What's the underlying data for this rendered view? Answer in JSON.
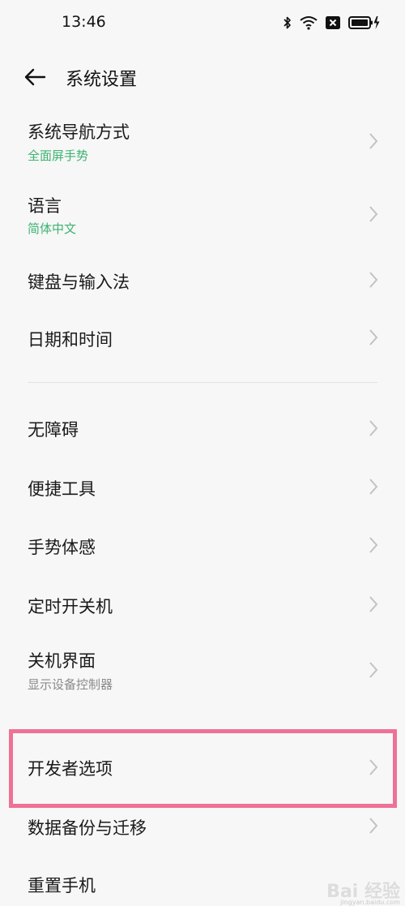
{
  "status_bar": {
    "time": "13:46",
    "icons": [
      "bluetooth-icon",
      "wifi-icon",
      "sim-disabled-icon",
      "battery-charging-icon"
    ]
  },
  "header": {
    "title": "系统设置",
    "back_icon": "arrow-left-icon"
  },
  "items": [
    {
      "title": "系统导航方式",
      "subtitle": "全面屏手势",
      "subtitle_color": "#3cb371"
    },
    {
      "title": "语言",
      "subtitle": "简体中文",
      "subtitle_color": "#3cb371"
    },
    {
      "title": "键盘与输入法"
    },
    {
      "title": "日期和时间"
    },
    {
      "title": "无障碍"
    },
    {
      "title": "便捷工具"
    },
    {
      "title": "手势体感"
    },
    {
      "title": "定时开关机"
    },
    {
      "title": "关机界面",
      "subtitle": "显示设备控制器",
      "subtitle_color": "#8a8a8a"
    },
    {
      "title": "开发者选项",
      "highlighted": true
    },
    {
      "title": "数据备份与迁移"
    },
    {
      "title": "重置手机"
    }
  ],
  "colors": {
    "background": "#f7f7f7",
    "accent": "#3cb371",
    "highlight": "#ee7196"
  },
  "watermark": {
    "text": "Bai 经验",
    "url": "jingyan.baidu.com"
  }
}
